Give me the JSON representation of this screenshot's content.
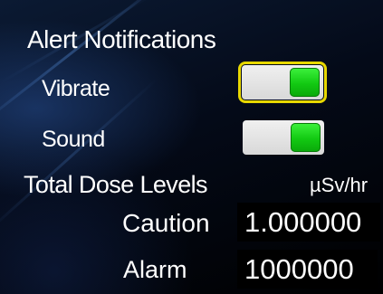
{
  "alerts": {
    "title": "Alert Notifications",
    "vibrate": {
      "label": "Vibrate",
      "enabled": true
    },
    "sound": {
      "label": "Sound",
      "enabled": true
    }
  },
  "dose": {
    "title": "Total Dose Levels",
    "unit": "µSv/hr",
    "caution": {
      "label": "Caution",
      "value": "1.000000"
    },
    "alarm": {
      "label": "Alarm",
      "value": "1000000"
    }
  },
  "colors": {
    "toggle_on": "#22dd22",
    "focus_outline": "#e8d800",
    "toggle_track": "#e0e0e0",
    "value_bg": "#000000"
  }
}
